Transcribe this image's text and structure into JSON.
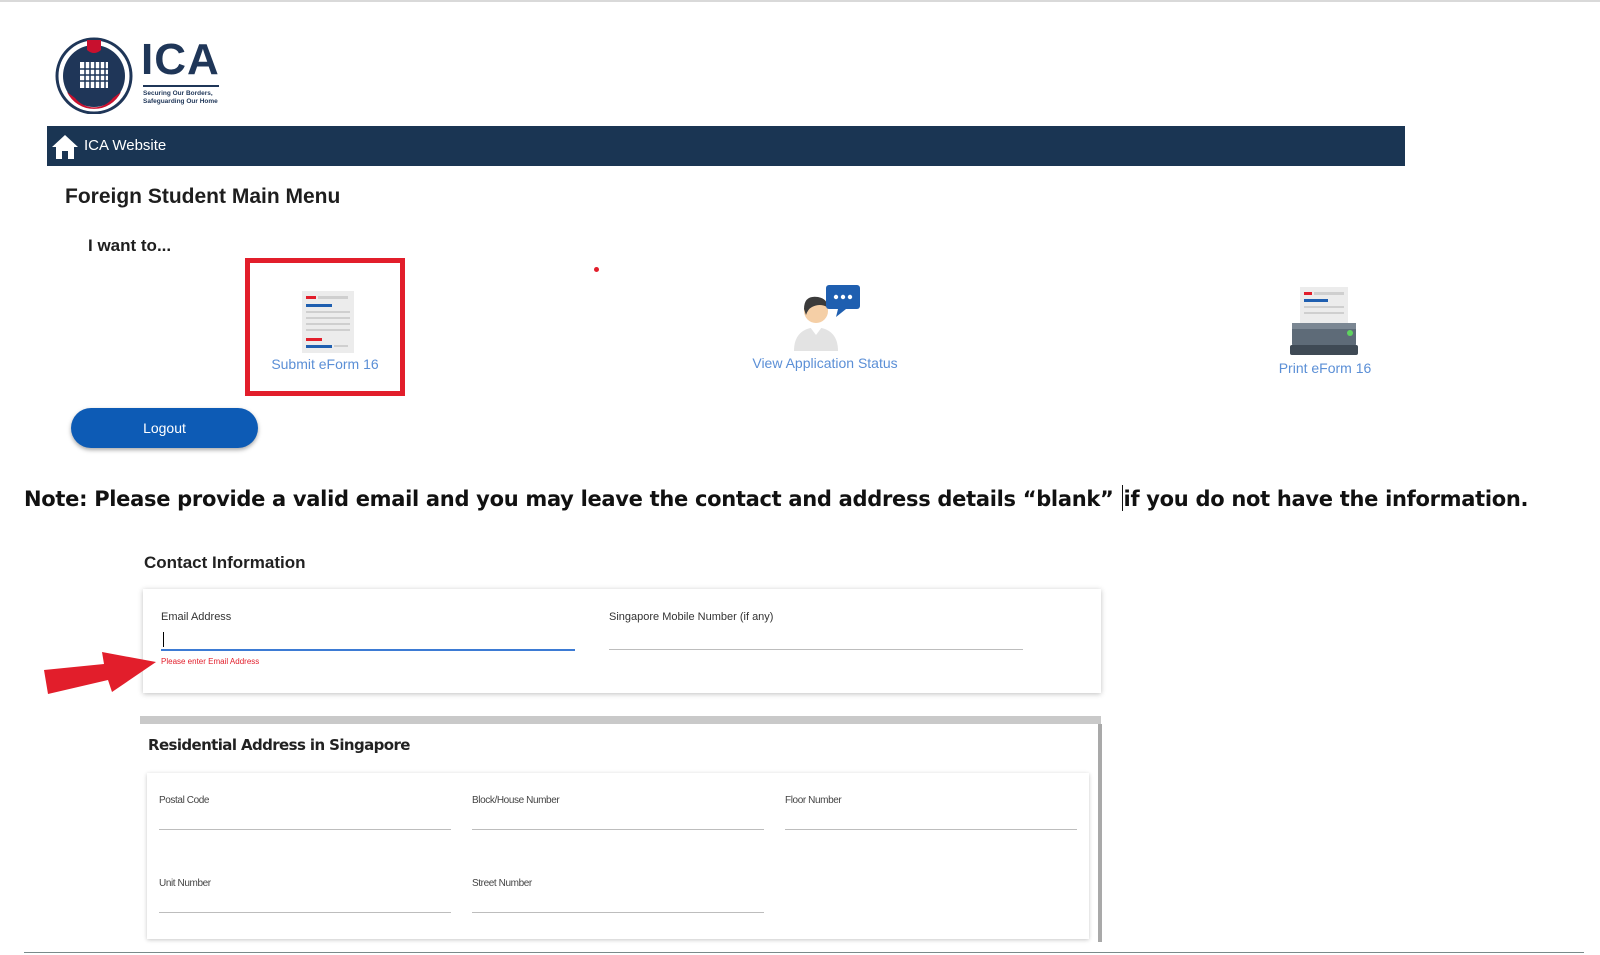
{
  "header": {
    "logo_text": "ICA",
    "logo_tagline_1": "Securing Our Borders,",
    "logo_tagline_2": "Safeguarding Our Home"
  },
  "navbar": {
    "home_link_label": "ICA Website"
  },
  "main": {
    "title": "Foreign Student Main Menu",
    "prompt": "I want to...",
    "options": [
      {
        "label": "Submit eForm 16",
        "icon": "form-document-icon",
        "highlighted": true
      },
      {
        "label": "View Application Status",
        "icon": "person-chat-icon"
      },
      {
        "label": "Print eForm 16",
        "icon": "printer-icon"
      }
    ],
    "logout_label": "Logout"
  },
  "note": {
    "before_caret": "Note: Please provide a valid email and you may leave the contact and address details “blank” ",
    "after_caret": "if you do not have the information."
  },
  "contact": {
    "section_title": "Contact Information",
    "email_label": "Email Address",
    "email_value": "",
    "email_error": "Please enter Email Address",
    "mobile_label": "Singapore Mobile Number (if any)",
    "mobile_value": ""
  },
  "address": {
    "section_title": "Residential Address in Singapore",
    "postal_label": "Postal Code",
    "block_label": "Block/House Number",
    "floor_label": "Floor Number",
    "unit_label": "Unit Number",
    "street_label": "Street Number"
  },
  "colors": {
    "navbar": "#1a3553",
    "highlight_box": "#e21e2b",
    "option_label": "#5b8fd6",
    "logout_button": "#0d5bb5",
    "error_text": "#e21e2b"
  }
}
